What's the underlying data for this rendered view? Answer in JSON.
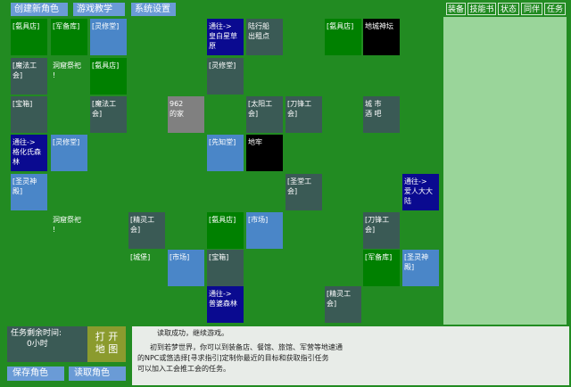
{
  "menu": {
    "create_role": "创建新角色",
    "tutorial": "游戏教学",
    "settings": "系统设置"
  },
  "tabs": [
    "装备",
    "技能书",
    "状态",
    "同伴",
    "任务"
  ],
  "map_cells": [
    {
      "label": "[氨具店]",
      "style": "green"
    },
    {
      "label": "[军备库]",
      "style": "green"
    },
    {
      "label": "[灵修堂]",
      "style": "blue"
    },
    {
      "label": "通往->\n皇白星草原",
      "style": "navy"
    },
    {
      "label": "陆行船\n出租点",
      "style": "dark"
    },
    {
      "label": "[氨具店]",
      "style": "green"
    },
    {
      "label": "地城神坛",
      "style": "black"
    },
    {
      "label": "[魔法工会]",
      "style": "dark"
    },
    {
      "label": "洞窟祭祀 !",
      "style": "plain"
    },
    {
      "label": "[氨具店]",
      "style": "green"
    },
    {
      "label": "[灵修堂]",
      "style": "dark"
    },
    {
      "label": "[宝箱]",
      "style": "dark"
    },
    {
      "label": "[魔法工会]",
      "style": "dark"
    },
    {
      "label": "962\n的家",
      "style": "gray"
    },
    {
      "label": "[太阳工会]",
      "style": "dark"
    },
    {
      "label": "[刀锋工会]",
      "style": "dark"
    },
    {
      "label": "城 市\n酒 吧",
      "style": "dark"
    },
    {
      "label": "通往->\n格化氏森林",
      "style": "navy"
    },
    {
      "label": "[灵修堂]",
      "style": "blue"
    },
    {
      "label": "[先知堂]",
      "style": "blue"
    },
    {
      "label": "地牢",
      "style": "black"
    },
    {
      "label": "[圣灵神殿]",
      "style": "blue"
    },
    {
      "label": "[圣堂工会]",
      "style": "dark"
    },
    {
      "label": "通往->\n爱人大大陆",
      "style": "navy"
    },
    {
      "label": "洞窟祭祀 !",
      "style": "plain"
    },
    {
      "label": "[精灵工会]",
      "style": "dark"
    },
    {
      "label": "[氨具店]",
      "style": "green"
    },
    {
      "label": "[市场]",
      "style": "blue"
    },
    {
      "label": "[刀锋工会]",
      "style": "dark"
    },
    {
      "label": "[城堡]",
      "style": "plain"
    },
    {
      "label": "[市场]",
      "style": "blue"
    },
    {
      "label": "[宝箱]",
      "style": "dark"
    },
    {
      "label": "[军备库]",
      "style": "green"
    },
    {
      "label": "[圣灵神殿]",
      "style": "blue"
    },
    {
      "label": "通往->\n普婆森林",
      "style": "navy"
    },
    {
      "label": "[精灵工会]",
      "style": "dark"
    }
  ],
  "timer": {
    "label": "任务剩余时间:",
    "value": "0小时"
  },
  "open_map": "打 开\n地 图",
  "save_role": "保存角色",
  "load_role": "读取角色",
  "log": {
    "line1": "读取成功，继续游戏。",
    "line2": "初到若梦世界，你可以到装备店、餐馆、旅馆、军营等地速通",
    "line3": "的NPC或悠选择[寻求指引]定制你最近的目标和获取指引任务",
    "line4": "可以加入工会推工会的任务。"
  }
}
